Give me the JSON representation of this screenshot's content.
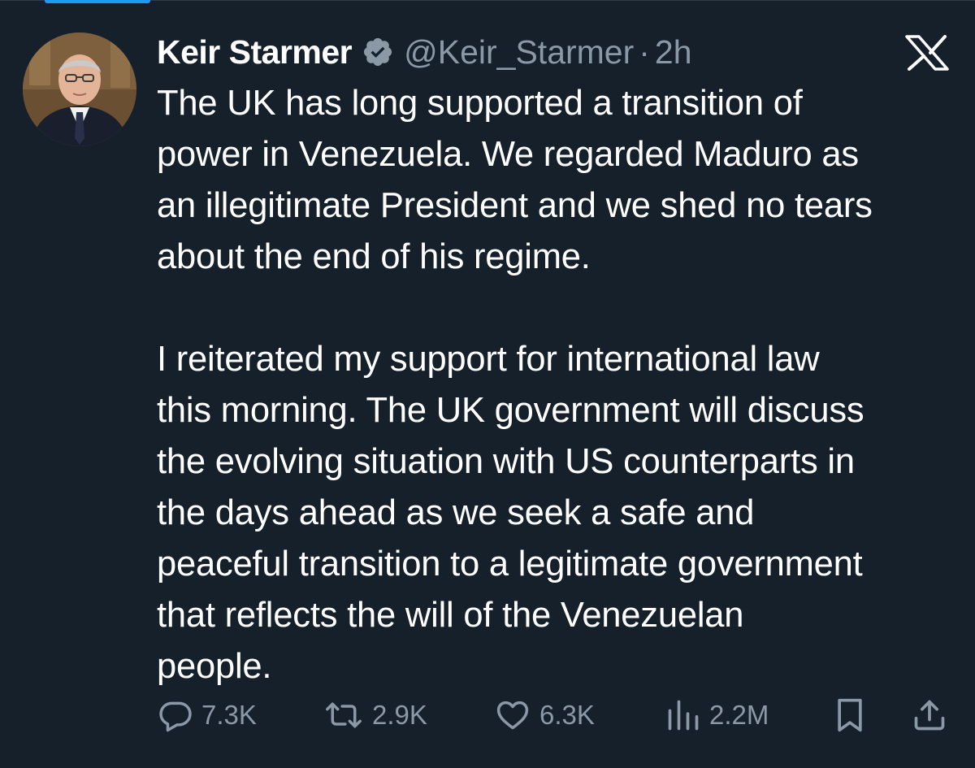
{
  "tweet": {
    "author": {
      "display_name": "Keir Starmer",
      "verified": true,
      "handle": "@Keir_Starmer",
      "timestamp": "2h",
      "separator": "·"
    },
    "platform_icon": "x-logo-icon",
    "text": "The UK has long supported a transition of\npower in Venezuela. We regarded Maduro as\nan illegitimate President and we shed no tears\nabout the end of his regime.\n\nI reiterated my support for international law\nthis morning. The UK government will discuss\nthe evolving situation with US counterparts in\nthe days ahead as we seek a safe and\npeaceful transition to a legitimate government\nthat reflects the will of the Venezuelan\npeople.",
    "stats": {
      "replies": "7.3K",
      "retweets": "2.9K",
      "likes": "6.3K",
      "views": "2.2M"
    }
  },
  "icons": {
    "reply": "reply-icon",
    "retweet": "retweet-icon",
    "like": "heart-icon",
    "views": "views-icon",
    "bookmark": "bookmark-icon",
    "share": "share-icon",
    "verified": "verified-badge-icon"
  },
  "colors": {
    "background": "#15202b",
    "text_primary": "#ffffff",
    "text_secondary": "#8b98a5",
    "accent": "#1d9bf0"
  }
}
